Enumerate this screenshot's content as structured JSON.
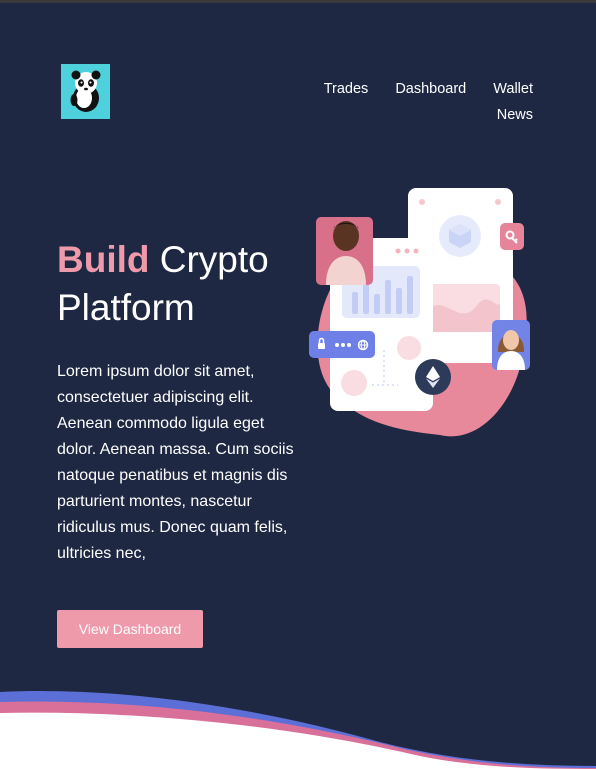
{
  "nav": {
    "items": [
      "Trades",
      "Dashboard",
      "Wallet",
      "News"
    ]
  },
  "hero": {
    "title_accent": "Build",
    "title_rest": "Crypto Platform",
    "body": "Lorem ipsum dolor sit amet, consectetuer adipiscing elit. Aenean commodo ligula eget dolor. Aenean massa. Cum sociis natoque penatibus et magnis dis parturient montes, nascetur ridiculus mus. Donec quam felis, ultricies nec,",
    "cta_label": "View Dashboard"
  },
  "colors": {
    "background": "#1f2842",
    "accent_pink": "#ef9aaa",
    "logo_cyan": "#4fd1dd",
    "wave_blue": "#5b6fd6"
  },
  "icons": [
    "panda-logo-icon",
    "lock-icon",
    "globe-icon",
    "ethereum-icon",
    "cube-icon",
    "key-icon"
  ]
}
